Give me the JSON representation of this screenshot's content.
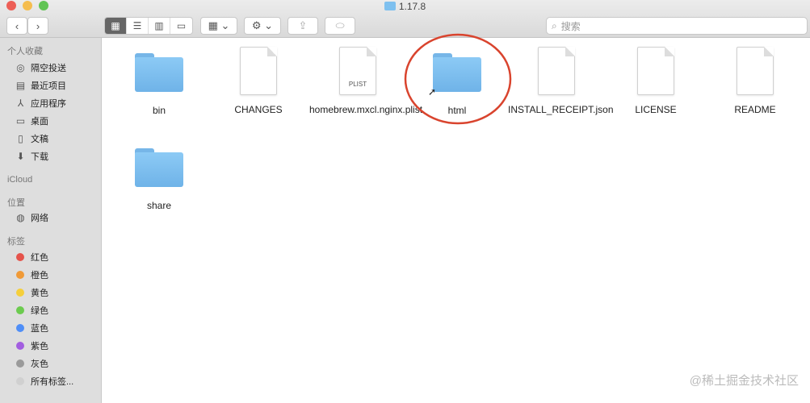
{
  "window": {
    "title": "1.17.8"
  },
  "toolbar": {
    "back": "‹",
    "forward": "›",
    "search_placeholder": "搜索"
  },
  "sidebar": {
    "favorites_header": "个人收藏",
    "favorites": [
      {
        "label": "隔空投送",
        "icon": "airdrop-icon"
      },
      {
        "label": "最近项目",
        "icon": "recents-icon"
      },
      {
        "label": "应用程序",
        "icon": "applications-icon"
      },
      {
        "label": "桌面",
        "icon": "desktop-icon"
      },
      {
        "label": "文稿",
        "icon": "documents-icon"
      },
      {
        "label": "下载",
        "icon": "downloads-icon"
      }
    ],
    "icloud_header": "iCloud",
    "locations_header": "位置",
    "locations": [
      {
        "label": "网络",
        "icon": "network-icon"
      }
    ],
    "tags_header": "标签",
    "tags": [
      {
        "label": "红色",
        "color": "#e5534b"
      },
      {
        "label": "橙色",
        "color": "#f09a37"
      },
      {
        "label": "黄色",
        "color": "#f5cf3b"
      },
      {
        "label": "绿色",
        "color": "#6ccb4f"
      },
      {
        "label": "蓝色",
        "color": "#4f8ef7"
      },
      {
        "label": "紫色",
        "color": "#a25ee0"
      },
      {
        "label": "灰色",
        "color": "#9a9a9a"
      },
      {
        "label": "所有标签...",
        "color": "#d0d0d0"
      }
    ]
  },
  "files": [
    {
      "name": "bin",
      "kind": "folder"
    },
    {
      "name": "CHANGES",
      "kind": "doc"
    },
    {
      "name": "homebrew.mxcl.nginx.plist",
      "kind": "doc",
      "badge": "PLIST"
    },
    {
      "name": "html",
      "kind": "folder-alias",
      "highlighted": true
    },
    {
      "name": "INSTALL_RECEIPT.json",
      "kind": "doc"
    },
    {
      "name": "LICENSE",
      "kind": "doc"
    },
    {
      "name": "README",
      "kind": "doc"
    },
    {
      "name": "share",
      "kind": "folder"
    }
  ],
  "annotation_color": "#d9442e",
  "watermark": "@稀土掘金技术社区"
}
